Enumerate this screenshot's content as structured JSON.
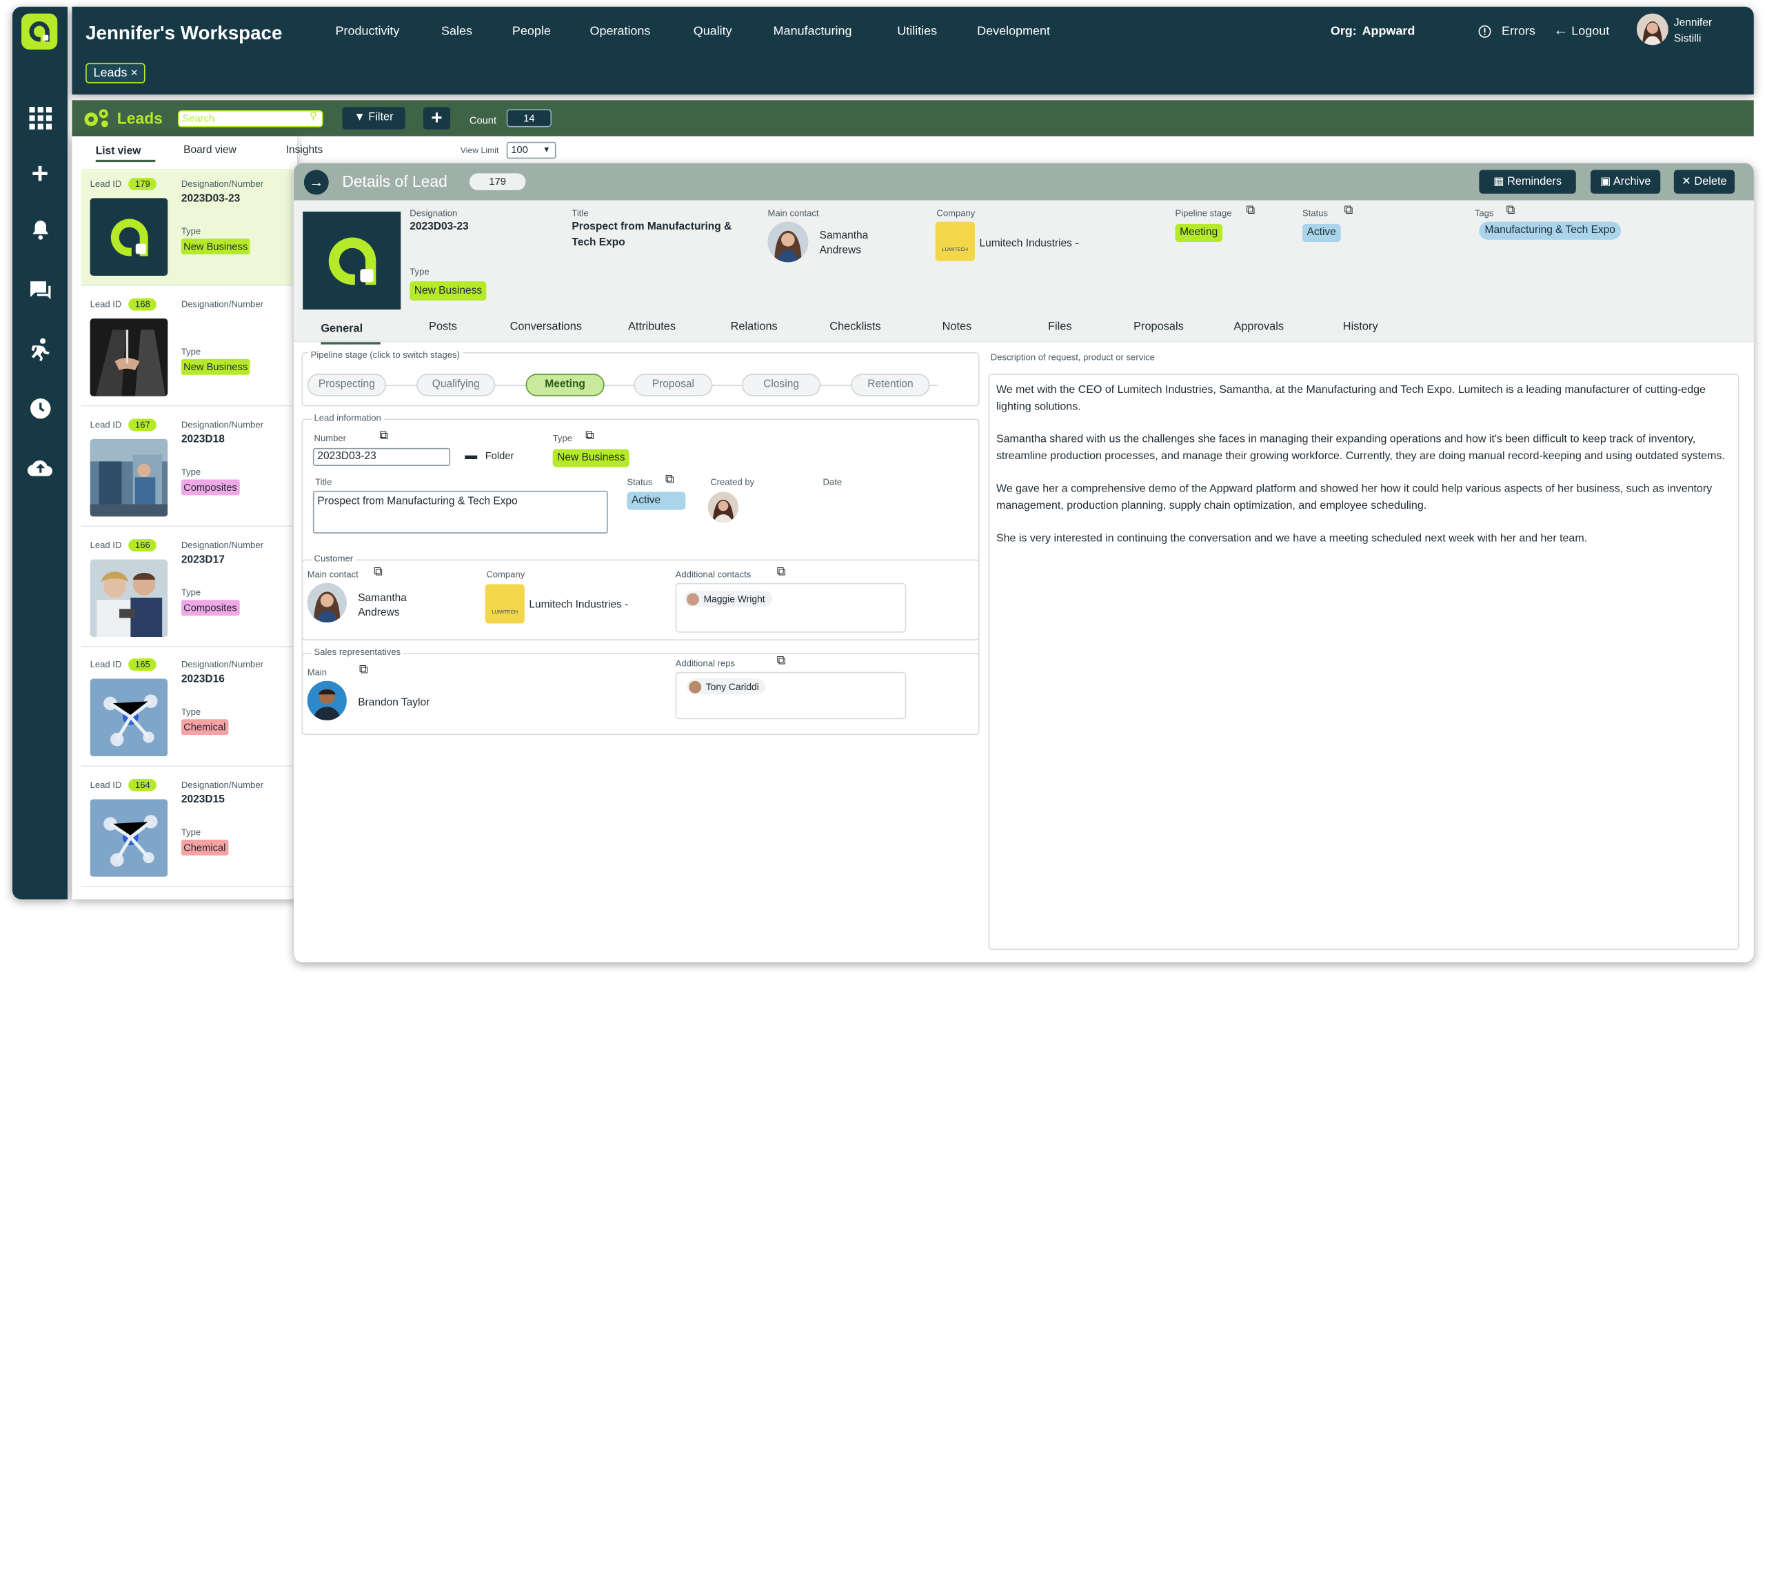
{
  "header": {
    "workspace_title": "Jennifer's Workspace",
    "org_label": "Org:",
    "org_name": "Appward",
    "errors_label": "Errors",
    "logout_label": "Logout",
    "user_first": "Jennifer",
    "user_last": "Sistilli"
  },
  "nav": [
    "Productivity",
    "Sales",
    "People",
    "Operations",
    "Quality",
    "Manufacturing",
    "Utilities",
    "Development"
  ],
  "open_tab": {
    "label": "Leads",
    "close": "×"
  },
  "leads_bar": {
    "title": "Leads",
    "search_placeholder": "Search",
    "filter_label": "Filter",
    "add_label": "+",
    "count_label": "Count",
    "count_value": "14",
    "view_limit_label": "View Limit",
    "view_limit_value": "100"
  },
  "view_tabs": [
    "List view",
    "Board view",
    "Insights"
  ],
  "lead_list_labels": {
    "id": "Lead ID",
    "designation": "Designation/Number",
    "type": "Type"
  },
  "leads": [
    {
      "id": "179",
      "designation": "2023D03-23",
      "type": "New Business",
      "type_kind": "nb"
    },
    {
      "id": "168",
      "designation": "",
      "type": "New Business",
      "type_kind": "nb"
    },
    {
      "id": "167",
      "designation": "2023D18",
      "type": "Composites",
      "type_kind": "comp"
    },
    {
      "id": "166",
      "designation": "2023D17",
      "type": "Composites",
      "type_kind": "comp"
    },
    {
      "id": "165",
      "designation": "2023D16",
      "type": "Chemical",
      "type_kind": "chem"
    },
    {
      "id": "164",
      "designation": "2023D15",
      "type": "Chemical",
      "type_kind": "chem"
    }
  ],
  "detail": {
    "title": "Details of Lead",
    "id": "179",
    "actions": {
      "reminders": "Reminders",
      "archive": "Archive",
      "delete": "Delete"
    },
    "designation_label": "Designation",
    "designation": "2023D03-23",
    "title_label": "Title",
    "title_line1": "Prospect from Manufacturing &",
    "title_line2": "Tech Expo",
    "type_label": "Type",
    "type": "New Business",
    "main_contact_label": "Main contact",
    "main_contact_first": "Samantha",
    "main_contact_last": "Andrews",
    "company_label": "Company",
    "company": "Lumitech Industries -",
    "company_logo_text": "LUMITECH",
    "pipeline_label": "Pipeline stage",
    "pipeline": "Meeting",
    "status_label": "Status",
    "status": "Active",
    "tags_label": "Tags",
    "tag": "Manufacturing & Tech Expo"
  },
  "tabs": [
    "General",
    "Posts",
    "Conversations",
    "Attributes",
    "Relations",
    "Checklists",
    "Notes",
    "Files",
    "Proposals",
    "Approvals",
    "History"
  ],
  "pipeline": {
    "caption": "Pipeline stage (click to switch stages)",
    "stages": [
      "Prospecting",
      "Qualifying",
      "Meeting",
      "Proposal",
      "Closing",
      "Retention"
    ],
    "active_index": 2
  },
  "lead_info": {
    "caption": "Lead information",
    "number_label": "Number",
    "number": "2023D03-23",
    "folder_label": "Folder",
    "type_label": "Type",
    "type": "New Business",
    "title_label": "Title",
    "title": "Prospect from Manufacturing & Tech Expo",
    "status_label": "Status",
    "status": "Active",
    "created_by_label": "Created by",
    "date_label": "Date"
  },
  "customer": {
    "caption": "Customer",
    "main_contact_label": "Main contact",
    "contact_first": "Samantha",
    "contact_last": "Andrews",
    "company_label": "Company",
    "company": "Lumitech Industries -",
    "additional_label": "Additional contacts",
    "additional": [
      "Maggie Wright"
    ]
  },
  "sales": {
    "caption": "Sales representatives",
    "main_label": "Main",
    "main": "Brandon Taylor",
    "additional_label": "Additional reps",
    "additional": [
      "Tony Cariddi"
    ]
  },
  "description": {
    "caption": "Description of request, product or service",
    "paragraphs": [
      "We met with the CEO of Lumitech Industries, Samantha, at the Manufacturing and Tech Expo. Lumitech is a leading manufacturer of cutting-edge lighting solutions.",
      "Samantha shared with us the challenges she faces in managing their expanding operations and how it's been difficult to keep track of inventory, streamline production processes, and manage their growing workforce. Currently, they are doing manual record-keeping and using outdated systems.",
      "We gave her a comprehensive demo of the Appward platform and showed her how it could help various aspects of her business, such as inventory management, production planning, supply chain optimization, and employee scheduling.",
      "She is very interested in continuing the conversation and we have a meeting scheduled next week with her and her team."
    ]
  },
  "colors": {
    "navy": "#173945",
    "lime": "#b6ea29",
    "green_bar": "#3f6346",
    "active_blue": "#a9d4ea",
    "composites": "#f0a9e6",
    "chemical": "#f7a3a3"
  }
}
